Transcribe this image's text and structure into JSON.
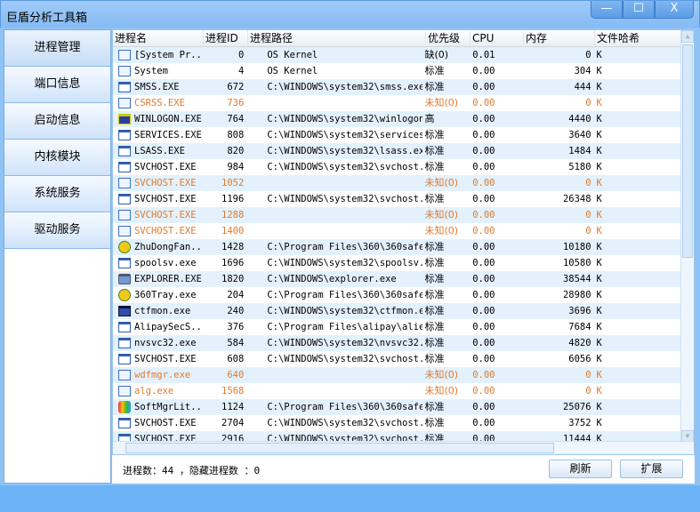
{
  "window": {
    "title": "巨盾分析工具箱",
    "minimize": "—",
    "maximize": "☐",
    "close": "X"
  },
  "sidebar": {
    "items": [
      {
        "label": "进程管理"
      },
      {
        "label": "端口信息"
      },
      {
        "label": "启动信息"
      },
      {
        "label": "内核模块"
      },
      {
        "label": "系统服务"
      },
      {
        "label": "驱动服务"
      }
    ]
  },
  "table": {
    "columns": [
      "进程名",
      "进程ID",
      "进程路径",
      "优先级",
      "CPU",
      "内存",
      "文件哈希"
    ],
    "rows": [
      {
        "icon": "sys",
        "name": "[System Pr...",
        "pid": "0",
        "path": "OS Kernel",
        "priority": "缺(0)",
        "cpu": "0.01",
        "mem": "0",
        "unit": "K",
        "hidden": false
      },
      {
        "icon": "sys",
        "name": "System",
        "pid": "4",
        "path": "OS Kernel",
        "priority": "标准",
        "cpu": "0.00",
        "mem": "304",
        "unit": "K",
        "hidden": false
      },
      {
        "icon": "app",
        "name": "SMSS.EXE",
        "pid": "672",
        "path": "C:\\WINDOWS\\system32\\smss.exe",
        "priority": "标准",
        "cpu": "0.00",
        "mem": "444",
        "unit": "K",
        "hidden": false
      },
      {
        "icon": "sys",
        "name": "CSRSS.EXE",
        "pid": "736",
        "path": "",
        "priority": "未知(0)",
        "cpu": "0.00",
        "mem": "0",
        "unit": "K",
        "hidden": true
      },
      {
        "icon": "logon",
        "name": "WINLOGON.EXE",
        "pid": "764",
        "path": "C:\\WINDOWS\\system32\\winlogon.exe",
        "priority": "高",
        "cpu": "0.00",
        "mem": "4440",
        "unit": "K",
        "hidden": false
      },
      {
        "icon": "app",
        "name": "SERVICES.EXE",
        "pid": "808",
        "path": "C:\\WINDOWS\\system32\\services.exe",
        "priority": "标准",
        "cpu": "0.00",
        "mem": "3640",
        "unit": "K",
        "hidden": false
      },
      {
        "icon": "app",
        "name": "LSASS.EXE",
        "pid": "820",
        "path": "C:\\WINDOWS\\system32\\lsass.exe",
        "priority": "标准",
        "cpu": "0.00",
        "mem": "1484",
        "unit": "K",
        "hidden": false
      },
      {
        "icon": "app",
        "name": "SVCHOST.EXE",
        "pid": "984",
        "path": "C:\\WINDOWS\\system32\\svchost.exe",
        "priority": "标准",
        "cpu": "0.00",
        "mem": "5180",
        "unit": "K",
        "hidden": false
      },
      {
        "icon": "sys",
        "name": "SVCHOST.EXE",
        "pid": "1052",
        "path": "",
        "priority": "未知(0)",
        "cpu": "0.00",
        "mem": "0",
        "unit": "K",
        "hidden": true
      },
      {
        "icon": "app",
        "name": "SVCHOST.EXE",
        "pid": "1196",
        "path": "C:\\WINDOWS\\system32\\svchost.exe",
        "priority": "标准",
        "cpu": "0.00",
        "mem": "26348",
        "unit": "K",
        "hidden": false
      },
      {
        "icon": "sys",
        "name": "SVCHOST.EXE",
        "pid": "1288",
        "path": "",
        "priority": "未知(0)",
        "cpu": "0.00",
        "mem": "0",
        "unit": "K",
        "hidden": true
      },
      {
        "icon": "sys",
        "name": "SVCHOST.EXE",
        "pid": "1400",
        "path": "",
        "priority": "未知(0)",
        "cpu": "0.00",
        "mem": "0",
        "unit": "K",
        "hidden": true
      },
      {
        "icon": "green",
        "name": "ZhuDongFan...",
        "pid": "1428",
        "path": "C:\\Program Files\\360\\360safe\\d...",
        "priority": "标准",
        "cpu": "0.00",
        "mem": "10180",
        "unit": "K",
        "hidden": false
      },
      {
        "icon": "app",
        "name": "spoolsv.exe",
        "pid": "1696",
        "path": "C:\\WINDOWS\\system32\\spoolsv.exe",
        "priority": "标准",
        "cpu": "0.00",
        "mem": "10580",
        "unit": "K",
        "hidden": false
      },
      {
        "icon": "gear",
        "name": "EXPLORER.EXE",
        "pid": "1820",
        "path": "C:\\WINDOWS\\explorer.exe",
        "priority": "标准",
        "cpu": "0.00",
        "mem": "38544",
        "unit": "K",
        "hidden": false
      },
      {
        "icon": "green",
        "name": "360Tray.exe",
        "pid": "204",
        "path": "C:\\Program Files\\360\\360safe\\s...",
        "priority": "标准",
        "cpu": "0.00",
        "mem": "28980",
        "unit": "K",
        "hidden": false
      },
      {
        "icon": "pen",
        "name": "ctfmon.exe",
        "pid": "240",
        "path": "C:\\WINDOWS\\system32\\ctfmon.exe",
        "priority": "标准",
        "cpu": "0.00",
        "mem": "3696",
        "unit": "K",
        "hidden": false
      },
      {
        "icon": "app",
        "name": "AlipaySecS...",
        "pid": "376",
        "path": "C:\\Program Files\\alipay\\aliedi...",
        "priority": "标准",
        "cpu": "0.00",
        "mem": "7684",
        "unit": "K",
        "hidden": false
      },
      {
        "icon": "app",
        "name": "nvsvc32.exe",
        "pid": "584",
        "path": "C:\\WINDOWS\\system32\\nvsvc32.exe",
        "priority": "标准",
        "cpu": "0.00",
        "mem": "4820",
        "unit": "K",
        "hidden": false
      },
      {
        "icon": "app",
        "name": "SVCHOST.EXE",
        "pid": "608",
        "path": "C:\\WINDOWS\\system32\\svchost.exe",
        "priority": "标准",
        "cpu": "0.00",
        "mem": "6056",
        "unit": "K",
        "hidden": false
      },
      {
        "icon": "sys",
        "name": "wdfmgr.exe",
        "pid": "640",
        "path": "",
        "priority": "未知(0)",
        "cpu": "0.00",
        "mem": "0",
        "unit": "K",
        "hidden": true
      },
      {
        "icon": "sys",
        "name": "alg.exe",
        "pid": "1568",
        "path": "",
        "priority": "未知(0)",
        "cpu": "0.00",
        "mem": "0",
        "unit": "K",
        "hidden": true
      },
      {
        "icon": "multi",
        "name": "SoftMgrLit...",
        "pid": "1124",
        "path": "C:\\Program Files\\360\\360safe\\S...",
        "priority": "标准",
        "cpu": "0.00",
        "mem": "25076",
        "unit": "K",
        "hidden": false
      },
      {
        "icon": "app",
        "name": "SVCHOST.EXE",
        "pid": "2704",
        "path": "C:\\WINDOWS\\system32\\svchost.exe",
        "priority": "标准",
        "cpu": "0.00",
        "mem": "3752",
        "unit": "K",
        "hidden": false
      },
      {
        "icon": "app",
        "name": "SVCHOST.EXE",
        "pid": "2916",
        "path": "C:\\WINDOWS\\system32\\svchost.exe",
        "priority": "标准",
        "cpu": "0.00",
        "mem": "11444",
        "unit": "K",
        "hidden": false
      }
    ]
  },
  "status": {
    "text": "进程数：44 ，隐藏进程数 ：0"
  },
  "buttons": {
    "refresh": "刷新",
    "extend": "扩展"
  },
  "colors": {
    "hidden_process": "#e07a2e",
    "accent": "#8fc3f6"
  }
}
